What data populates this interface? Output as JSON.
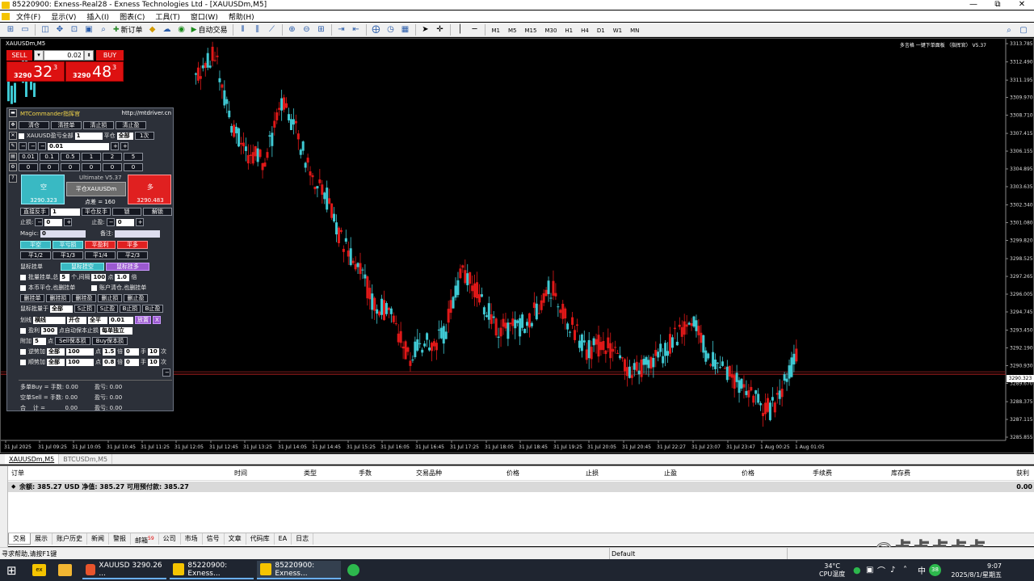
{
  "window": {
    "title": "85220900: Exness-Real28 - Exness Technologies Ltd - [XAUUSDm,M5]",
    "minimize": "—",
    "maximize": "⧉",
    "close": "✕"
  },
  "menu": [
    "文件(F)",
    "显示(V)",
    "插入(I)",
    "图表(C)",
    "工具(T)",
    "窗口(W)",
    "帮助(H)"
  ],
  "toolbar": {
    "new_order": "新订单",
    "autotrading": "自动交易",
    "timeframes": [
      "M1",
      "M5",
      "M15",
      "M30",
      "H1",
      "H4",
      "D1",
      "W1",
      "MN"
    ]
  },
  "chart": {
    "label": "XAUUSDm,M5",
    "indicator_title": "多言格 一键下单面板 （指挥官） V5.37",
    "price_tag": "3290.323",
    "y_axis": [
      "3313.785",
      "3312.490",
      "3311.195",
      "3309.970",
      "3308.710",
      "3307.415",
      "3306.155",
      "3304.895",
      "3303.635",
      "3302.340",
      "3301.080",
      "3299.820",
      "3298.525",
      "3297.265",
      "3296.005",
      "3294.745",
      "3293.450",
      "3292.190",
      "3290.930",
      "3290.323",
      "3289.670",
      "3288.375",
      "3287.115",
      "3285.855"
    ],
    "x_axis": [
      "31 Jul 2025",
      "31 Jul 09:25",
      "31 Jul 10:05",
      "31 Jul 10:45",
      "31 Jul 11:25",
      "31 Jul 12:05",
      "31 Jul 12:45",
      "31 Jul 13:25",
      "31 Jul 14:05",
      "31 Jul 14:45",
      "31 Jul 15:25",
      "31 Jul 16:05",
      "31 Jul 16:45",
      "31 Jul 17:25",
      "31 Jul 18:05",
      "31 Jul 18:45",
      "31 Jul 19:25",
      "31 Jul 20:05",
      "31 Jul 20:45",
      "31 Jul 22:27",
      "31 Jul 23:07",
      "31 Jul 23:47",
      "1 Aug 00:25",
      "1 Aug 01:05"
    ],
    "colors": {
      "bull": "#3fc9d3",
      "bear": "#e01818",
      "bg": "#000000",
      "grid": "#222222",
      "price_line": "#b02020"
    }
  },
  "oneclick": {
    "sell": "SELL",
    "buy": "BUY",
    "lot": "0.02",
    "sell_small": "3290",
    "sell_big": "32",
    "sell_sup": "3",
    "buy_small": "3290",
    "buy_big": "48",
    "buy_sup": "3"
  },
  "mtc": {
    "title": "MTCommander指挥官",
    "url": "http://mtdriver.cn",
    "r1": [
      "清仓",
      "清挂单",
      "清止损",
      "清止盈"
    ],
    "r2_sym": "XAUUSD盈亏全部",
    "r2_val": "1",
    "r2_b": "平仓",
    "r2_c": "全部",
    "r2_d": "1次",
    "r3_val": "0.01",
    "r4": [
      "0.01",
      "0.1",
      "0.5",
      "1",
      "2",
      "5"
    ],
    "r5": [
      "0",
      "0",
      "0",
      "0",
      "0",
      "0"
    ],
    "short_label": "空",
    "short_price": "3290.323",
    "version": "Ultimate V5.37",
    "close_btn": "平仓XAUUSDm",
    "spread": "点差 = 160",
    "long_label": "多",
    "long_price": "3290.483",
    "r6": [
      "直接反手",
      "1",
      "平仓反手",
      "锁",
      "解锁"
    ],
    "sl_label": "止损:",
    "sl_val": "0",
    "tp_label": "止盈:",
    "tp_val": "0",
    "magic_label": "Magic:",
    "magic_val": "0",
    "note_label": "备注:",
    "r7": [
      "平空",
      "平亏损",
      "平盈利",
      "平多"
    ],
    "r8": [
      "平1/2",
      "平1/3",
      "平1/4",
      "平2/3"
    ],
    "mouse_pending": "鼠标挂单",
    "mouse_short": "鼠标挂空",
    "mouse_long": "鼠标挂多",
    "batch": "批量挂单,总",
    "batch_n": "5",
    "batch_gap": "个,间隔",
    "batch_gap_v": "100",
    "batch_pt": "点",
    "batch_mult": "1.0",
    "batch_times": "倍",
    "chk1": "本币平仓,也删挂单",
    "chk2": "账户清仓,也删挂单",
    "r9": [
      "删挂单",
      "删挂损",
      "删挂盈",
      "删止损",
      "删止盈"
    ],
    "r10_label": "鼠标批量于",
    "r10_v": "全部",
    "r10": [
      "S止损",
      "S止盈",
      "B止损",
      "B止盈"
    ],
    "draw_label": "划线",
    "draw_v": "横线",
    "draw_open": "开仓",
    "draw_all": "全平",
    "draw_lot": "0.01",
    "draw_place": "放置",
    "draw_x": "X",
    "profit_chk": "盈利",
    "profit_v": "300",
    "profit_txt": "点自动保本止损",
    "profit_mode": "每单独立",
    "add_label": "附加",
    "add_v": "5",
    "add_pt": "点",
    "add_sell": "Sell保本损",
    "add_buy": "Buy保本损",
    "rev_label": "逆势加",
    "rev_v": "全部",
    "rev_n": "100",
    "rev_p": "点",
    "rev_m": "1.5",
    "rev_x": "倍",
    "rev_z": "0",
    "rev_h": "手",
    "rev_c": "10",
    "rev_t": "次",
    "trd_label": "顺势加",
    "trd_v": "全部",
    "trd_n": "100",
    "trd_p": "点",
    "trd_m": "0.8",
    "trd_x": "倍",
    "trd_z": "0",
    "trd_h": "手",
    "trd_c": "10",
    "trd_t": "次",
    "sum_buy": "多单Buy = 手数: 0.00",
    "sum_buy_p": "盈亏: 0.00",
    "sum_sell": "空单Sell = 手数: 0.00",
    "sum_sell_p": "盈亏: 0.00",
    "sum_tot": "合    计 =           0.00",
    "sum_tot_p": "盈亏: 0.00"
  },
  "chart_tabs": [
    "XAUUSDm,M5",
    "BTCUSDm,M5"
  ],
  "terminal": {
    "cols": [
      "订单",
      "时间",
      "类型",
      "手数",
      "交易品种",
      "价格",
      "止损",
      "止盈",
      "价格",
      "手续费",
      "库存费",
      "获利"
    ],
    "balance": "余额: 385.27 USD  净值: 385.27  可用预付款: 385.27",
    "profit": "0.00",
    "tabs": [
      "交易",
      "展示",
      "账户历史",
      "新闻",
      "警报",
      "邮箱",
      "公司",
      "市场",
      "信号",
      "文章",
      "代码库",
      "EA",
      "日志"
    ],
    "mail_badge": "59"
  },
  "status": {
    "help": "寻求帮助,请按F1键",
    "profile": "Default"
  },
  "taskbar": {
    "app1": "XAUUSD 3290.26 ...",
    "app2": "85220900: Exness...",
    "app3": "85220900: Exness...",
    "temp": "34°C",
    "cpu": "CPU温度",
    "ime": "中",
    "badge": "38",
    "time": "9:07",
    "date": "2025/8/1/星期五"
  },
  "watermark": "@点点点点点"
}
